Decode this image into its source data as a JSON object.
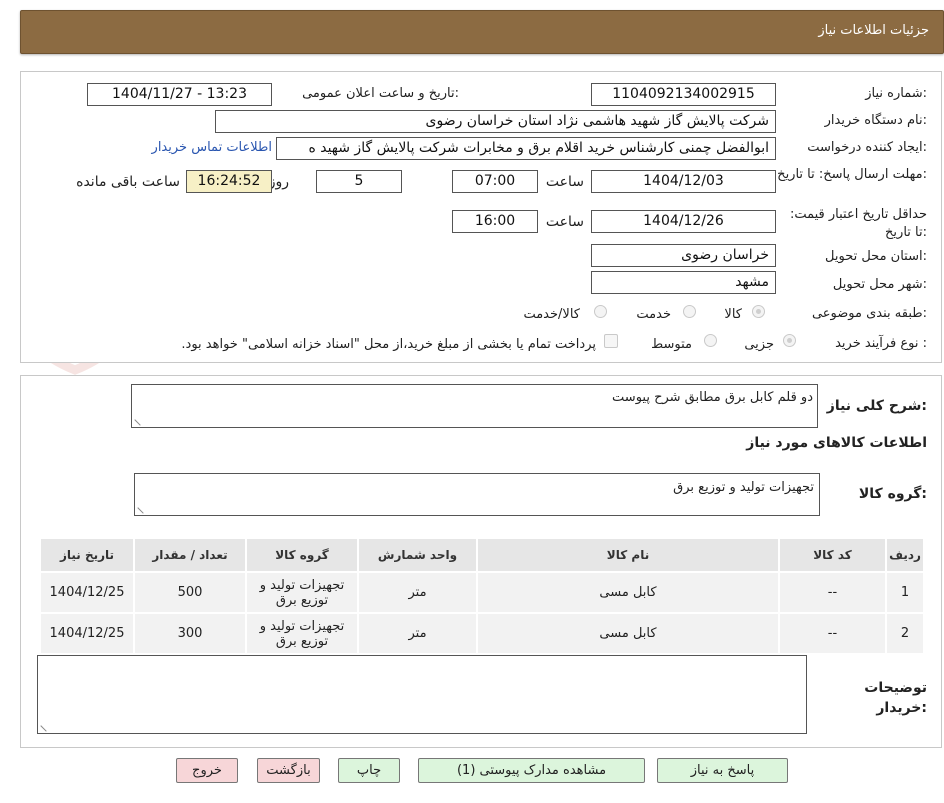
{
  "header": {
    "title": "جزئیات اطلاعات نیاز"
  },
  "form": {
    "need_number_label": "شماره نیاز:",
    "need_number": "1104092134002915",
    "announce_label": "تاریخ و ساعت اعلان عمومی:",
    "announce_value": "1404/11/27 - 13:23",
    "buyer_org_label": "نام دستگاه خریدار:",
    "buyer_org": "شرکت پالایش گاز شهید هاشمی نژاد   استان خراسان رضوی",
    "requester_label": "ایجاد کننده درخواست:",
    "requester": "ابوالفضل چمنی کارشناس خرید اقلام برق و مخابرات شرکت پالایش گاز شهید ه",
    "contact_link": "اطلاعات تماس خریدار",
    "deadline_label": "مهلت ارسال پاسخ: تا تاریخ:",
    "deadline_date": "1404/12/03",
    "time_label": "ساعت",
    "deadline_time": "07:00",
    "days_value": "5",
    "days_label": "روز و",
    "remaining_time": "16:24:52",
    "remaining_label": "ساعت باقی مانده",
    "validity_label": "حداقل تاریخ اعتبار قیمت: تا تاریخ:",
    "validity_date": "1404/12/26",
    "validity_time": "16:00",
    "province_label": "استان محل تحویل:",
    "province": "خراسان رضوی",
    "city_label": "شهر محل تحویل:",
    "city": "مشهد",
    "category_label": "طبقه بندی موضوعی:",
    "category_options": [
      "کالا",
      "خدمت",
      "کالا/خدمت"
    ],
    "process_label": "نوع فرآیند خرید :",
    "process_options": [
      "جزیی",
      "متوسط"
    ],
    "payment_note": "پرداخت تمام یا بخشی از مبلغ خرید،از محل \"اسناد خزانه اسلامی\" خواهد بود."
  },
  "description": {
    "label": "شرح کلی نیاز:",
    "value": "دو قلم کابل برق مطابق شرح پیوست",
    "goods_info_title": "اطلاعات کالاهای مورد نیاز",
    "goods_group_label": "گروه کالا:",
    "goods_group_value": "تجهیزات تولید و توزیع برق"
  },
  "table": {
    "headers": [
      "ردیف",
      "کد کالا",
      "نام کالا",
      "واحد شمارش",
      "گروه کالا",
      "تعداد / مقدار",
      "تاریخ نیاز"
    ],
    "rows": [
      [
        "1",
        "--",
        "کابل مسی",
        "متر",
        "تجهیزات تولید و توزیع برق",
        "500",
        "1404/12/25"
      ],
      [
        "2",
        "--",
        "کابل مسی",
        "متر",
        "تجهیزات تولید و توزیع برق",
        "300",
        "1404/12/25"
      ]
    ]
  },
  "notes": {
    "label": "توضیحات خریدار:",
    "value": ""
  },
  "buttons": {
    "reply": "پاسخ به نیاز",
    "view_docs": "مشاهده مدارک پیوستی (1)",
    "print": "چاپ",
    "back": "بازگشت",
    "exit": "خروج"
  },
  "watermark": {
    "text": "AriaTender.neT"
  },
  "colors": {
    "header_bg": "#8c6b42",
    "link": "#2a56b0",
    "highlight": "#f7f0c6",
    "btn_green": "#dcf5dc",
    "btn_pink": "#f7d6d8"
  }
}
